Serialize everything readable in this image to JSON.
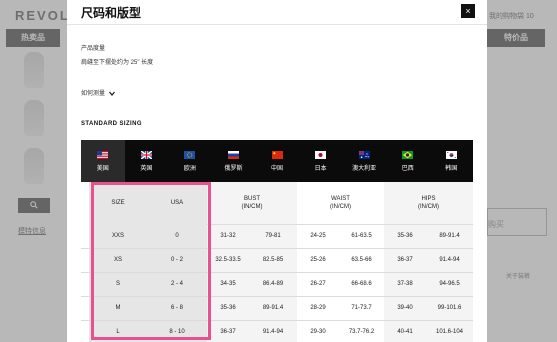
{
  "background": {
    "logo": "REVOLV",
    "hot_items": "热卖品",
    "wishlist": "我的购物袋 10",
    "special_items": "特价品",
    "search_icon": "search-icon",
    "link": "模特信息",
    "buy_button": "购买",
    "about": "关于装裤"
  },
  "modal": {
    "title": "尺码和版型",
    "close_icon": "close-icon",
    "close_label": "×",
    "dimension_label": "产品度量",
    "dimension_value": "肩缝至下摆处约为 25\" 长度",
    "measure_link": "如何测量",
    "measure_chevron": "chevron-down-icon",
    "standard_sizing": "STANDARD SIZING",
    "regions": [
      {
        "label": "美国",
        "flag": "us",
        "active": true
      },
      {
        "label": "英国",
        "flag": "uk"
      },
      {
        "label": "欧洲",
        "flag": "eu"
      },
      {
        "label": "俄罗斯",
        "flag": "ru"
      },
      {
        "label": "中国",
        "flag": "cn"
      },
      {
        "label": "日本",
        "flag": "jp"
      },
      {
        "label": "澳大利亚",
        "flag": "au"
      },
      {
        "label": "巴西",
        "flag": "br"
      },
      {
        "label": "韩国",
        "flag": "kr"
      }
    ],
    "table": {
      "headers": {
        "size": "SIZE",
        "usa": "USA",
        "bust": "BUST",
        "waist": "WAIST",
        "hips": "HIPS",
        "unit": "(IN/CM)"
      },
      "rows": [
        {
          "size": "XXS",
          "usa": "0",
          "bust_in": "31-32",
          "bust_cm": "79-81",
          "waist_in": "24-25",
          "waist_cm": "61-63.5",
          "hips_in": "35-36",
          "hips_cm": "89-91.4"
        },
        {
          "size": "XS",
          "usa": "0 - 2",
          "bust_in": "32.5-33.5",
          "bust_cm": "82.5-85",
          "waist_in": "25-26",
          "waist_cm": "63.5-66",
          "hips_in": "36-37",
          "hips_cm": "91.4-94"
        },
        {
          "size": "S",
          "usa": "2 - 4",
          "bust_in": "34-35",
          "bust_cm": "86.4-89",
          "waist_in": "26-27",
          "waist_cm": "66-68.6",
          "hips_in": "37-38",
          "hips_cm": "94-96.5"
        },
        {
          "size": "M",
          "usa": "6 - 8",
          "bust_in": "35-36",
          "bust_cm": "89-91.4",
          "waist_in": "28-29",
          "waist_cm": "71-73.7",
          "hips_in": "39-40",
          "hips_cm": "99-101.6"
        },
        {
          "size": "L",
          "usa": "8 - 10",
          "bust_in": "36-37",
          "bust_cm": "91.4-94",
          "waist_in": "29-30",
          "waist_cm": "73.7-76.2",
          "hips_in": "40-41",
          "hips_cm": "101.6-104"
        }
      ]
    },
    "highlight_color": "#e8508f"
  }
}
